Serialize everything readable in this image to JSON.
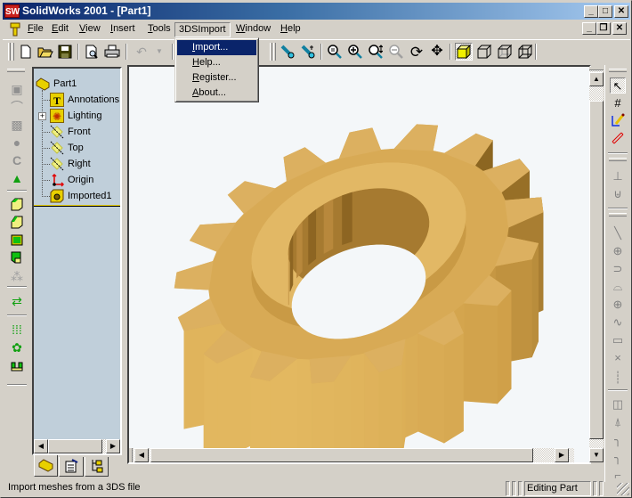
{
  "window": {
    "app_icon": "SW",
    "title": "SolidWorks 2001 - [Part1]",
    "controls": {
      "minimize": "_",
      "maximize": "□",
      "close": "✕"
    },
    "mdi_controls": {
      "minimize": "_",
      "restore": "❐",
      "close": "✕"
    }
  },
  "menubar": {
    "items": [
      {
        "label": "File",
        "mnemonic": "F"
      },
      {
        "label": "Edit",
        "mnemonic": "E"
      },
      {
        "label": "View",
        "mnemonic": "V"
      },
      {
        "label": "Insert",
        "mnemonic": "I"
      },
      {
        "label": "Tools",
        "mnemonic": "T"
      },
      {
        "label": "3DSImport",
        "mnemonic": "",
        "open": true
      },
      {
        "label": "Window",
        "mnemonic": "W"
      },
      {
        "label": "Help",
        "mnemonic": "H"
      }
    ]
  },
  "dropdown": {
    "items": [
      {
        "mn": "I",
        "rest": "mport...",
        "selected": true
      },
      {
        "mn": "H",
        "rest": "elp..."
      },
      {
        "mn": "R",
        "rest": "egister..."
      },
      {
        "mn": "A",
        "rest": "bout..."
      }
    ]
  },
  "toolbar": {
    "buttons": [
      "new-document-icon",
      "open-folder-icon",
      "save-icon",
      "print-preview-icon",
      "print-icon",
      "undo-icon",
      "undo-dropdown-icon",
      "select-icon",
      "smart-select-icon",
      "zoom-to-fit-icon",
      "zoom-in-icon",
      "zoom-area-icon",
      "zoom-out-icon",
      "rotate-view-icon",
      "pan-icon",
      "shaded-icon",
      "hidden-lines-removed-icon",
      "hidden-lines-gray-icon",
      "wireframe-icon"
    ]
  },
  "feature_tree": {
    "root": "Part1",
    "items": [
      {
        "label": "Annotations",
        "icon": "annotations-icon",
        "expandable": false
      },
      {
        "label": "Lighting",
        "icon": "lighting-icon",
        "expandable": true
      },
      {
        "label": "Front",
        "icon": "plane-icon",
        "expandable": false
      },
      {
        "label": "Top",
        "icon": "plane-icon",
        "expandable": false
      },
      {
        "label": "Right",
        "icon": "plane-icon",
        "expandable": false
      },
      {
        "label": "Origin",
        "icon": "origin-icon",
        "expandable": false
      },
      {
        "label": "Imported1",
        "icon": "imported-feature-icon",
        "expandable": false
      }
    ],
    "expand_symbol": "+",
    "tabs": [
      "feature-manager-tab",
      "property-manager-tab",
      "configuration-manager-tab"
    ]
  },
  "statusbar": {
    "message": "Import meshes from a 3DS file",
    "mode": "Editing Part"
  },
  "colors": {
    "title_start": "#0a246a",
    "title_end": "#a6caf0",
    "menu_highlight": "#0a246a",
    "tree_bg": "#c0cfda",
    "viewport_bg": "#f4f7f9",
    "gear_light": "#e3b860",
    "gear_mid": "#cf9f48",
    "gear_dark": "#8a6420",
    "rollback_bar": "#e8d000"
  }
}
